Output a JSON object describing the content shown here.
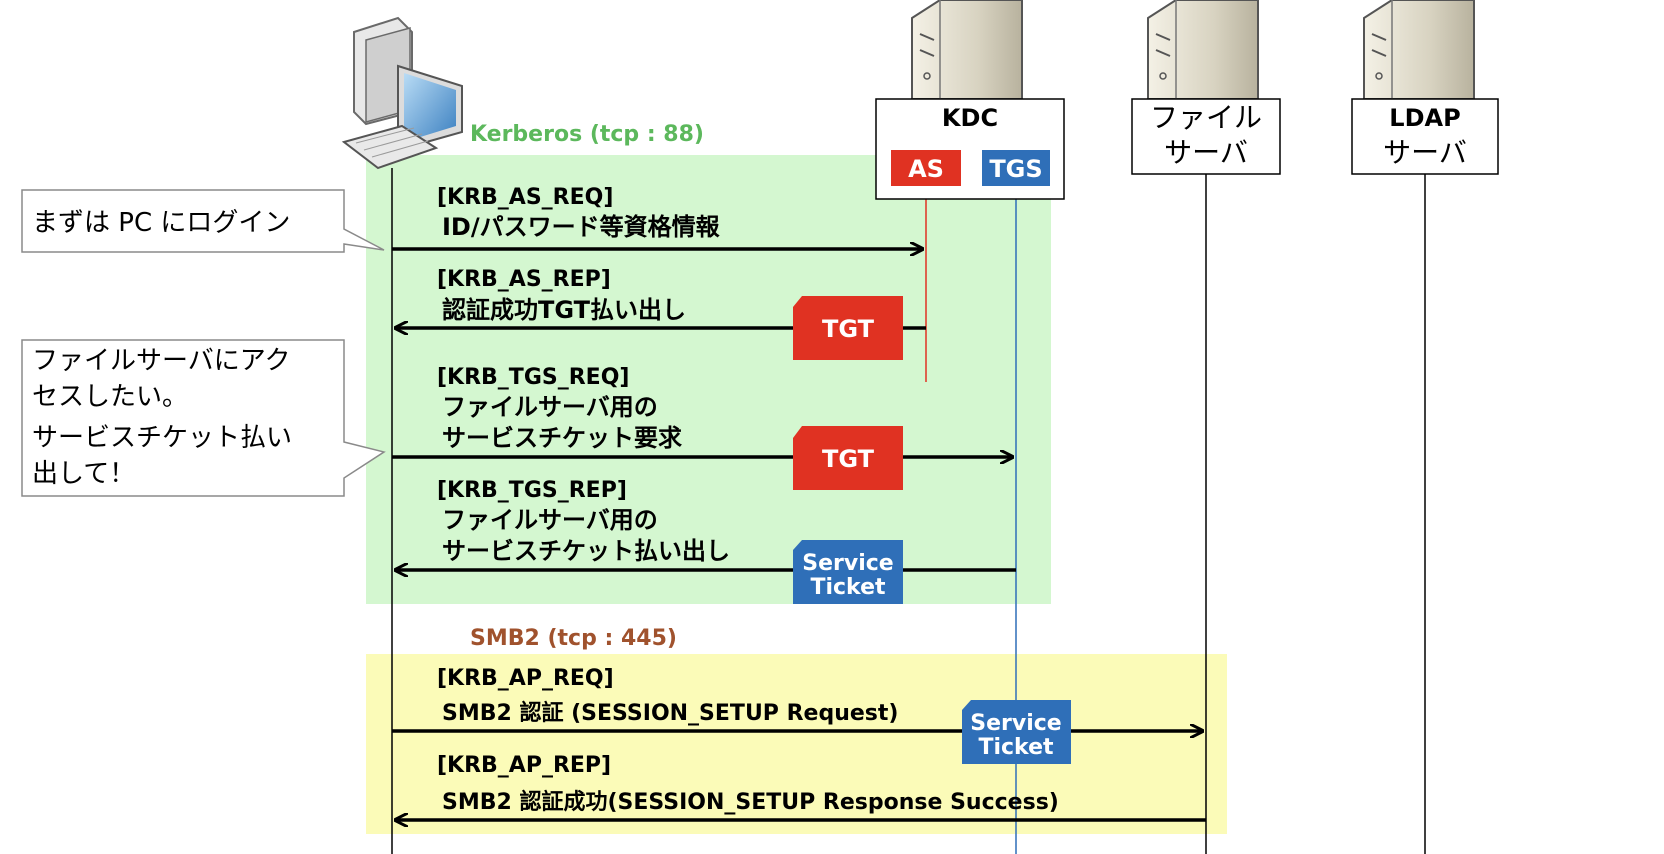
{
  "participants": {
    "kdc": "KDC",
    "as": "AS",
    "tgs": "TGS",
    "file_server": [
      "ファイル",
      "サーバ"
    ],
    "ldap_server": [
      "LDAP",
      "サーバ"
    ]
  },
  "sections": {
    "kerberos": "Kerberos (tcp : 88)",
    "smb2": "SMB2 (tcp : 445)"
  },
  "callouts": {
    "login": "まずは PC にログイン",
    "access": [
      "ファイルサーバにアク",
      "セスしたい。",
      "サービスチケット払い",
      "出して！"
    ]
  },
  "messages": [
    {
      "tag": "[KRB_AS_REQ]",
      "lines": [
        "ID/パスワード等資格情報"
      ]
    },
    {
      "tag": "[KRB_AS_REP]",
      "lines": [
        "認証成功TGT払い出し"
      ]
    },
    {
      "tag": "[KRB_TGS_REQ]",
      "lines": [
        "ファイルサーバ用の",
        "サービスチケット要求"
      ]
    },
    {
      "tag": "[KRB_TGS_REP]",
      "lines": [
        "ファイルサーバ用の",
        "サービスチケット払い出し"
      ]
    },
    {
      "tag": "[KRB_AP_REQ]",
      "lines": [
        "SMB2 認証 (SESSION_SETUP Request)"
      ]
    },
    {
      "tag": "[KRB_AP_REP]",
      "lines": [
        "SMB2 認証成功(SESSION_SETUP Response Success)"
      ]
    }
  ],
  "tickets": {
    "tgt": "TGT",
    "service": [
      "Service",
      "Ticket"
    ]
  },
  "colors": {
    "kerberos_bg": "#d4f7d0",
    "smb2_bg": "#fbfbb8",
    "kerberos_title": "#5cb85c",
    "smb2_title": "#a0522d",
    "as_red": "#e03222",
    "tgs_blue": "#2f6fb8",
    "arrow": "#000000"
  },
  "icons": [
    "computer-icon",
    "server-icon"
  ]
}
